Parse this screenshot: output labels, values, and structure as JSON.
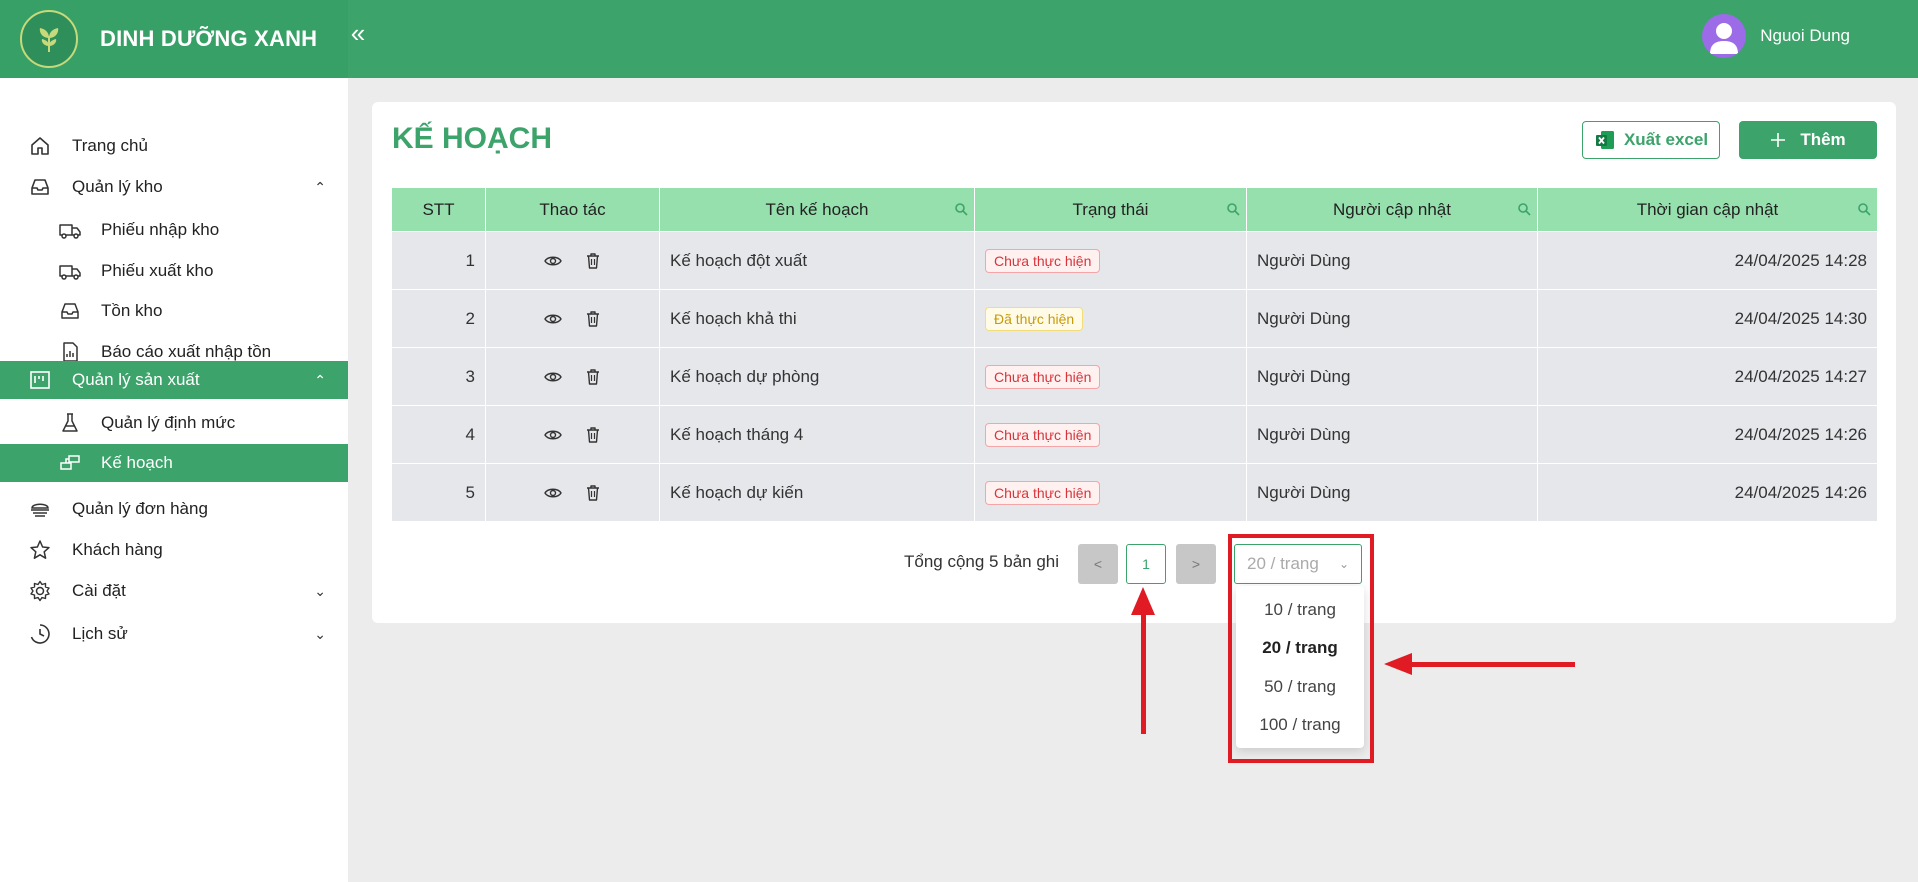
{
  "app": {
    "brand": "DINH DƯỠNG XANH",
    "collapse_icon": "«"
  },
  "user": {
    "name": "Nguoi Dung"
  },
  "sidebar": {
    "items": [
      {
        "label": "Trang chủ",
        "icon": "home-icon"
      },
      {
        "label": "Quản lý kho",
        "icon": "inbox-icon",
        "chevron": "⌃"
      },
      {
        "label": "Phiếu nhập kho",
        "icon": "truck-in-icon"
      },
      {
        "label": "Phiếu xuất kho",
        "icon": "truck-out-icon"
      },
      {
        "label": "Tồn kho",
        "icon": "inbox-icon"
      },
      {
        "label": "Báo cáo xuất nhập tồn",
        "icon": "report-icon"
      },
      {
        "label": "Quản lý sản xuất",
        "icon": "factory-icon",
        "chevron": "⌃"
      },
      {
        "label": "Quản lý định mức",
        "icon": "flask-icon"
      },
      {
        "label": "Kế hoạch",
        "icon": "plan-icon"
      },
      {
        "label": "Quản lý đơn hàng",
        "icon": "order-icon"
      },
      {
        "label": "Khách hàng",
        "icon": "star-icon"
      },
      {
        "label": "Cài đặt",
        "icon": "gear-icon",
        "chevron": "⌄"
      },
      {
        "label": "Lịch sử",
        "icon": "history-icon",
        "chevron": "⌄"
      }
    ]
  },
  "page": {
    "title": "KẾ HOẠCH",
    "export_label": "Xuất excel",
    "add_label": "Thêm"
  },
  "table": {
    "columns": [
      "STT",
      "Thao tác",
      "Tên kế hoạch",
      "Trạng thái",
      "Người cập nhật",
      "Thời gian cập nhật"
    ],
    "rows": [
      {
        "stt": "1",
        "name": "Kế hoạch đột xuất",
        "status": "Chưa thực hiện",
        "status_type": "red",
        "updater": "Người Dùng",
        "time": "24/04/2025 14:28"
      },
      {
        "stt": "2",
        "name": "Kế hoạch khả thi",
        "status": "Đã thực hiện",
        "status_type": "yellow",
        "updater": "Người Dùng",
        "time": "24/04/2025 14:30"
      },
      {
        "stt": "3",
        "name": "Kế hoạch dự phòng",
        "status": "Chưa thực hiện",
        "status_type": "red",
        "updater": "Người Dùng",
        "time": "24/04/2025 14:27"
      },
      {
        "stt": "4",
        "name": "Kế hoạch tháng 4",
        "status": "Chưa thực hiện",
        "status_type": "red",
        "updater": "Người Dùng",
        "time": "24/04/2025 14:26"
      },
      {
        "stt": "5",
        "name": "Kế hoạch dự kiến",
        "status": "Chưa thực hiện",
        "status_type": "red",
        "updater": "Người Dùng",
        "time": "24/04/2025 14:26"
      }
    ]
  },
  "pagination": {
    "total_text": "Tổng cộng 5 bản ghi",
    "prev": "<",
    "current_page": "1",
    "next": ">",
    "page_size": "20 / trang",
    "options": [
      "10 / trang",
      "20 / trang",
      "50 / trang",
      "100 / trang"
    ]
  },
  "colors": {
    "primary": "#3ca36b",
    "table_header": "#96e0ad",
    "annotation": "#e01b24"
  }
}
